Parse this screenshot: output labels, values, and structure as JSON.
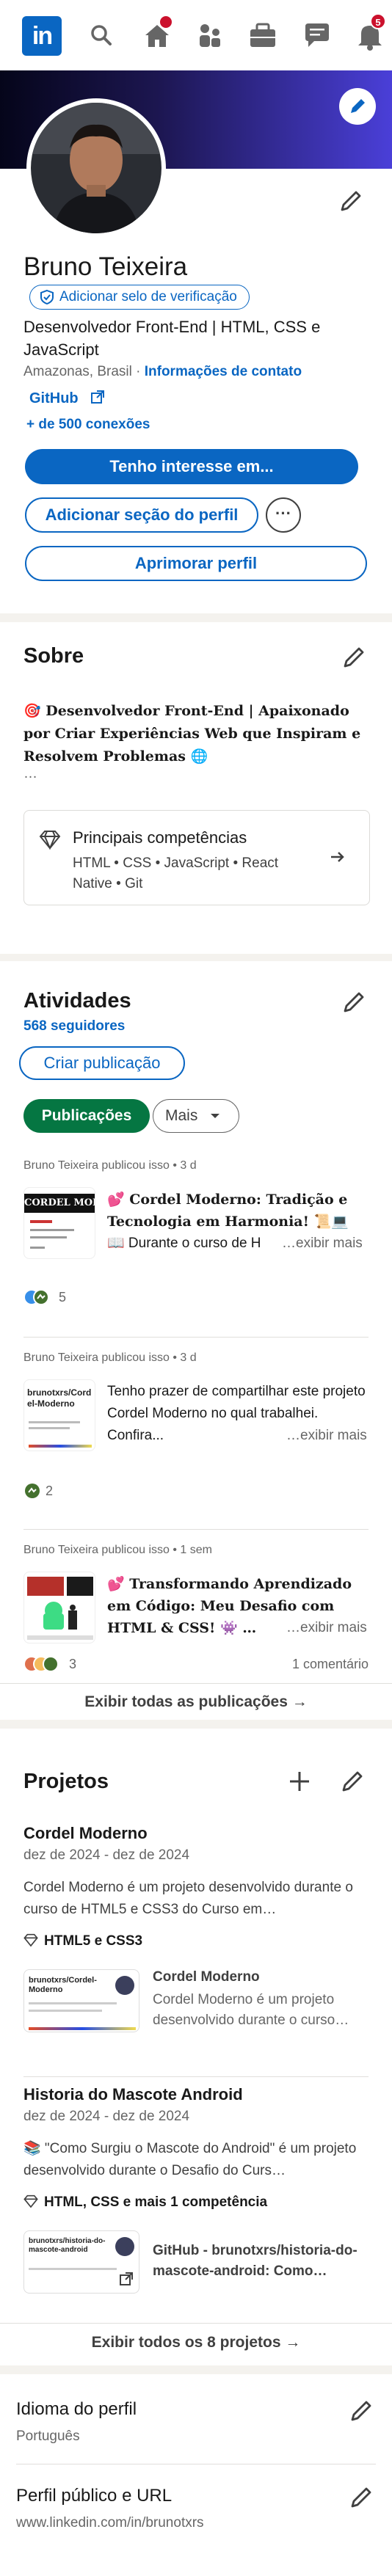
{
  "nav": {
    "logo_text": "in",
    "notifications_count": "5",
    "icons": [
      "search-icon",
      "home-icon",
      "my-network-icon",
      "jobs-icon",
      "messaging-icon",
      "notifications-icon"
    ]
  },
  "profile": {
    "name": "Bruno Teixeira",
    "verify_label": "Adicionar selo de verificação",
    "headline": "Desenvolvedor Front-End | HTML, CSS e JavaScript",
    "location": "Amazonas, Brasil",
    "location_sep": " · ",
    "contact_link": "Informações de contato",
    "github_link": "GitHub",
    "connections": "+ de 500 conexões",
    "open_to_btn": "Tenho interesse em...",
    "add_section_btn": "Adicionar seção do perfil",
    "more_btn": "···",
    "enhance_btn": "Aprimorar perfil"
  },
  "about": {
    "title": "Sobre",
    "text": "🎯 Desenvolvedor Front-End | Apaixonado por Criar Experiências Web que Inspiram e Resolvem Problemas 🌐",
    "ellipsis": "…",
    "skills_title": "Principais competências",
    "skills": "HTML • CSS • JavaScript • React Native • Git"
  },
  "activity": {
    "title": "Atividades",
    "followers": "568 seguidores",
    "create_btn": "Criar publicação",
    "tab_posts": "Publicações",
    "tab_more": "Mais",
    "posts": [
      {
        "meta_author": "Bruno Teixeira",
        "meta_rest": " publicou isso • 3 d",
        "title": "💕 Cordel Moderno: Tradição e Tecnologia em Harmonia! 📜💻",
        "body": "📖 Durante o curso de H",
        "more": "…exibir mais",
        "thumb_text": "CORDEL MODERNO",
        "reactions": "5",
        "comments": ""
      },
      {
        "meta_author": "Bruno Teixeira",
        "meta_rest": " publicou isso • 3 d",
        "title": "",
        "body": "Tenho prazer de compartilhar este projeto Cordel Moderno no qual trabalhei. Confira...",
        "more": "…exibir mais",
        "thumb_text": "brunotxrs/Cordel-Moderno",
        "reactions": "2",
        "comments": ""
      },
      {
        "meta_author": "Bruno Teixeira",
        "meta_rest": " publicou isso • 1 sem",
        "title": "💕 Transformando Aprendizado em Código: Meu Desafio com HTML & CSS! 👾 …",
        "body": "",
        "more": "…exibir mais",
        "thumb_text": "",
        "reactions": "3",
        "comments": "1 comentário"
      }
    ],
    "show_all": "Exibir todas as publicações →"
  },
  "projects": {
    "title": "Projetos",
    "items": [
      {
        "name": "Cordel Moderno",
        "dates": "dez de 2024 - dez de 2024",
        "desc": "Cordel Moderno é um projeto desenvolvido durante o curso de HTML5 e CSS3 do Curso em…",
        "skills": "HTML5 e CSS3",
        "media_title": "Cordel Moderno",
        "media_desc": "Cordel Moderno é um projeto desenvolvido durante o curso…",
        "media_thumb_text": "brunotxrs/Cordel-Moderno"
      },
      {
        "name": "Historia do Mascote Android",
        "dates": "dez de 2024 - dez de 2024",
        "desc": "📚 \"Como Surgiu o Mascote do Android\" é um projeto desenvolvido durante o Desafio do Curs…",
        "skills": "HTML, CSS e mais 1 competência",
        "media_title": "GitHub - brunotxrs/historia-do-mascote-android: Como…",
        "media_desc": "",
        "media_thumb_text": "brunotxrs/historia-do-mascote-android"
      }
    ],
    "show_all": "Exibir todos os 8 projetos →"
  },
  "language": {
    "title": "Idioma do perfil",
    "value": "Português"
  },
  "public_profile": {
    "title": "Perfil público e URL",
    "value": "www.linkedin.com/in/brunotxrs"
  },
  "colors": {
    "brand": "#0a66c2",
    "green": "#057642",
    "banner": "#4a3fd8"
  }
}
